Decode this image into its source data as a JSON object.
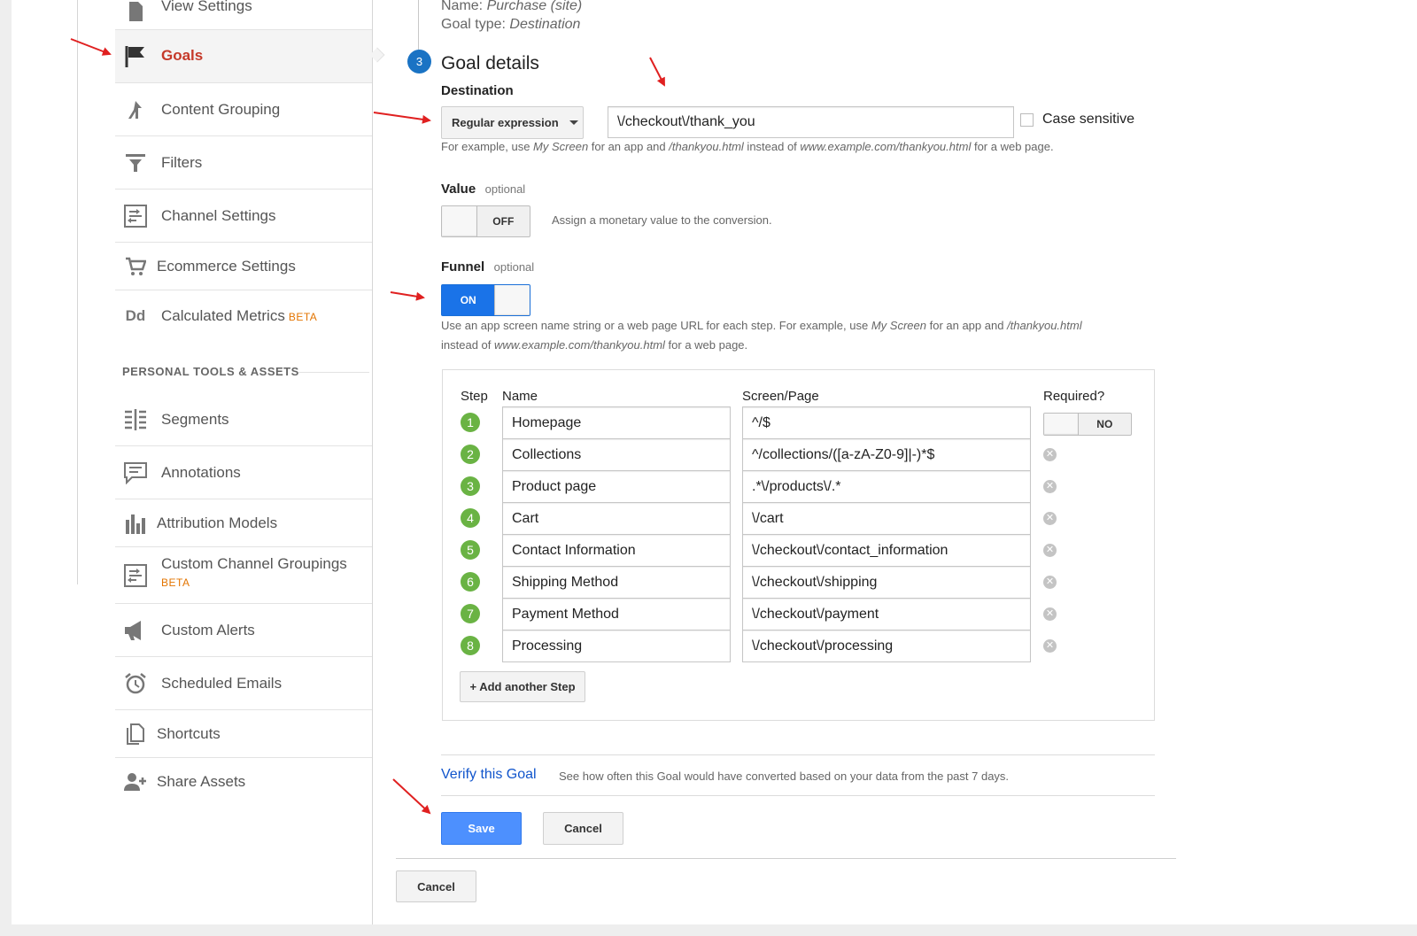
{
  "sidebar": {
    "items": [
      {
        "label": "View Settings",
        "icon": "doc-icon"
      },
      {
        "label": "Goals",
        "icon": "flag-icon",
        "active": true
      },
      {
        "label": "Content Grouping",
        "icon": "grouping-icon"
      },
      {
        "label": "Filters",
        "icon": "filter-icon"
      },
      {
        "label": "Channel Settings",
        "icon": "channel-icon"
      },
      {
        "label": "Ecommerce Settings",
        "icon": "cart-icon"
      },
      {
        "label": "Calculated Metrics",
        "beta": "BETA",
        "icon": "dd-icon"
      }
    ],
    "section_title": "PERSONAL TOOLS & ASSETS",
    "personal_items": [
      {
        "label": "Segments",
        "icon": "segments-icon"
      },
      {
        "label": "Annotations",
        "icon": "annotation-icon"
      },
      {
        "label": "Attribution Models",
        "icon": "bar-chart-icon"
      },
      {
        "label": "Custom Channel Groupings",
        "beta": "BETA",
        "icon": "channel-icon"
      },
      {
        "label": "Custom Alerts",
        "icon": "megaphone-icon"
      },
      {
        "label": "Scheduled Emails",
        "icon": "alarm-icon"
      },
      {
        "label": "Shortcuts",
        "icon": "shortcut-icon"
      },
      {
        "label": "Share Assets",
        "icon": "share-user-icon"
      }
    ]
  },
  "summary": {
    "name_label": "Name:",
    "name_value": "Purchase (site)",
    "type_label": "Goal type:",
    "type_value": "Destination"
  },
  "goal_details": {
    "step_number": "3",
    "title": "Goal details",
    "destination_label": "Destination",
    "match_type": "Regular expression",
    "destination_value": "\\/checkout\\/thank_you",
    "case_sensitive_label": "Case sensitive",
    "hint": {
      "p1": "For example, use ",
      "e1": "My Screen",
      "p2": " for an app and ",
      "e2": "/thankyou.html",
      "p3": " instead of ",
      "e3": "www.example.com/thankyou.html",
      "p4": " for a web page."
    }
  },
  "value": {
    "label": "Value",
    "optional": "optional",
    "toggle": "OFF",
    "hint": "Assign a monetary value to the conversion."
  },
  "funnel": {
    "label": "Funnel",
    "optional": "optional",
    "toggle": "ON",
    "hint": {
      "p1": "Use an app screen name string or a web page URL for each step. For example, use ",
      "e1": "My Screen",
      "p2": " for an app and ",
      "e2": "/thankyou.html",
      "p3": "instead of ",
      "e3": "www.example.com/thankyou.html",
      "p4": " for a web page."
    },
    "headers": {
      "step": "Step",
      "name": "Name",
      "page": "Screen/Page",
      "required": "Required?"
    },
    "required_toggle": "NO",
    "steps": [
      {
        "n": "1",
        "name": "Homepage",
        "page": "^/$"
      },
      {
        "n": "2",
        "name": "Collections",
        "page": "^/collections/([a-zA-Z0-9]|-)*$"
      },
      {
        "n": "3",
        "name": "Product page",
        "page": ".*\\/products\\/.*"
      },
      {
        "n": "4",
        "name": "Cart",
        "page": "\\/cart"
      },
      {
        "n": "5",
        "name": "Contact Information",
        "page": "\\/checkout\\/contact_information"
      },
      {
        "n": "6",
        "name": "Shipping Method",
        "page": "\\/checkout\\/shipping"
      },
      {
        "n": "7",
        "name": "Payment Method",
        "page": "\\/checkout\\/payment"
      },
      {
        "n": "8",
        "name": "Processing",
        "page": "\\/checkout\\/processing"
      }
    ],
    "add_step": "+ Add another Step"
  },
  "verify": {
    "link": "Verify this Goal",
    "desc": "See how often this Goal would have converted based on your data from the past 7 days."
  },
  "actions": {
    "save": "Save",
    "cancel": "Cancel",
    "outer_cancel": "Cancel"
  },
  "colors": {
    "accent_blue": "#4d90fe",
    "active_red": "#c53929",
    "step_green": "#6ab344",
    "annotation_arrow": "#e02020"
  }
}
